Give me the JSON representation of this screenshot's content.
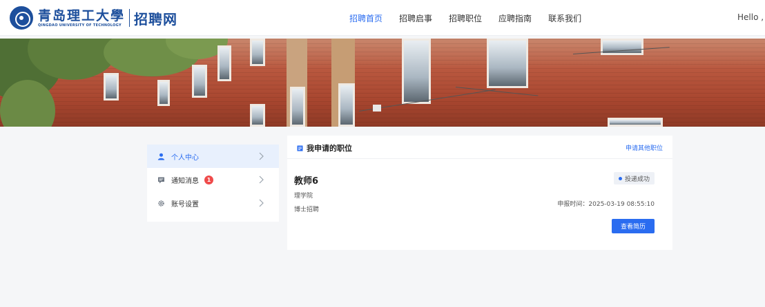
{
  "header": {
    "university_cn": "青岛理工大學",
    "university_en": "QINGDAO UNIVERSITY OF TECHNOLOGY",
    "site_name": "招聘网",
    "nav": [
      {
        "label": "招聘首页",
        "active": true
      },
      {
        "label": "招聘启事",
        "active": false
      },
      {
        "label": "招聘职位",
        "active": false
      },
      {
        "label": "应聘指南",
        "active": false
      },
      {
        "label": "联系我们",
        "active": false
      }
    ],
    "greeting": "Hello ,"
  },
  "sidebar": {
    "items": [
      {
        "label": "个人中心",
        "icon": "user-icon",
        "active": true
      },
      {
        "label": "通知消息",
        "icon": "message-icon",
        "badge": "1"
      },
      {
        "label": "账号设置",
        "icon": "gear-icon"
      }
    ]
  },
  "applications": {
    "title": "我申请的职位",
    "apply_other": "申请其他职位",
    "item": {
      "position": "教师6",
      "department": "理学院",
      "recruit_type": "博士招聘",
      "status": "投递成功",
      "applied_time": "申报时间：2025-03-19 08:55:10",
      "view_button": "查看简历"
    }
  },
  "colors": {
    "accent": "#2a6cf0",
    "brand": "#1d4f9c",
    "badge": "#ef4b4b"
  }
}
